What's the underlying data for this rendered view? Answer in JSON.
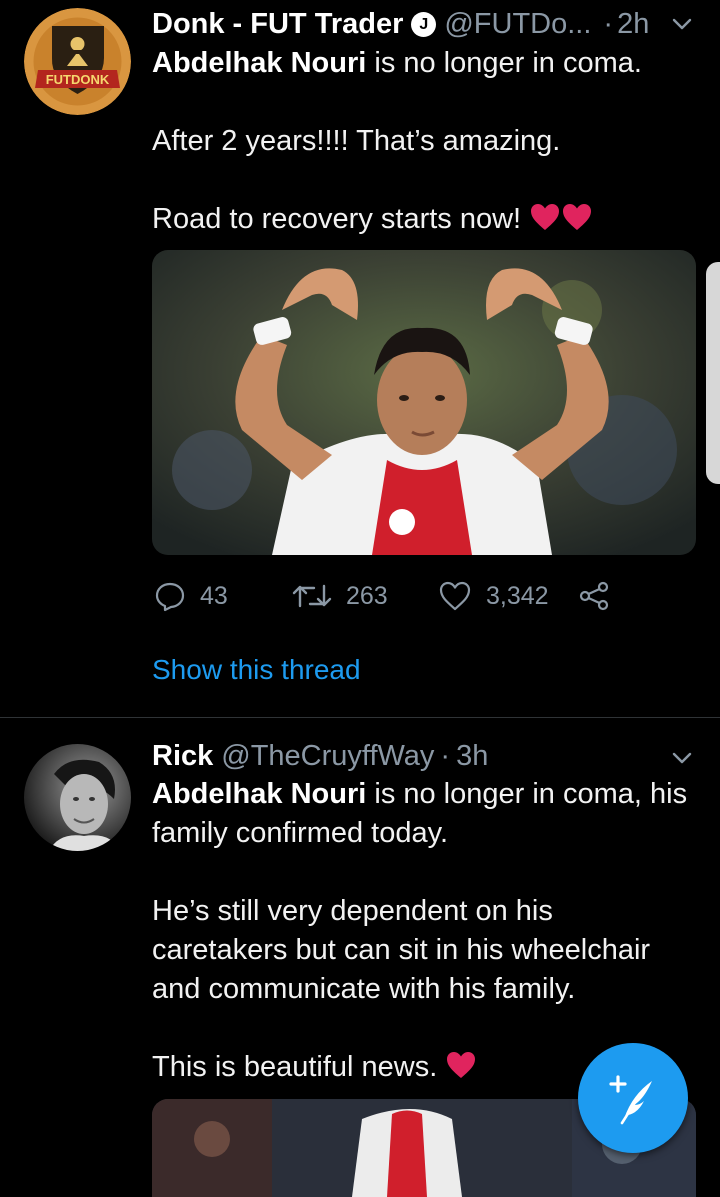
{
  "tweets": [
    {
      "author_name": "Donk - FUT Trader",
      "verified_badge": "J",
      "handle": "@FUTDo...",
      "separator": "·",
      "time": "2h",
      "avatar_label": "FUTDONK",
      "body_bold": "Abdelhak Nouri",
      "body_first_rest": " is no longer in coma.",
      "body_para2": "After 2 years!!!! That’s amazing.",
      "body_para3": "Road to recovery starts now!",
      "media_icon": "heart-hands-photo",
      "replies": "43",
      "retweets": "263",
      "likes": "3,342",
      "show_thread": "Show this thread"
    },
    {
      "author_name": "Rick",
      "handle": "@TheCruyffWay",
      "separator": "·",
      "time": "3h",
      "body_bold": "Abdelhak Nouri",
      "body_first_rest": " is no longer in coma, his family confirmed today.",
      "body_para2": "He’s still very dependent on his caretakers but can sit in his wheelchair and communicate with his family.",
      "body_para3": "This is beautiful news."
    }
  ],
  "fab": {
    "icon": "compose-feather-icon"
  },
  "colors": {
    "background": "#000000",
    "accent": "#1d9bf0",
    "secondary_text": "#8b98a5",
    "heart": "#e0245e"
  }
}
